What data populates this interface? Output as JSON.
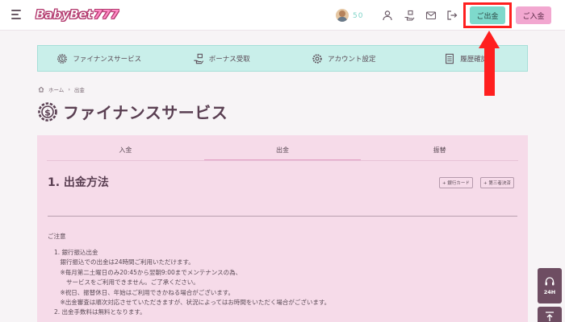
{
  "header": {
    "logo_text": "BabyBet",
    "logo_number": "777",
    "balance": "50",
    "withdraw_label": "ご出金",
    "deposit_label": "ご入金"
  },
  "service_nav": {
    "items": [
      {
        "label": "ファイナンスサービス",
        "icon": "dollar-gear-icon"
      },
      {
        "label": "ボーナス受取",
        "icon": "bonus-hand-icon"
      },
      {
        "label": "アカウント設定",
        "icon": "gear-icon"
      },
      {
        "label": "履歴確認",
        "icon": "document-icon"
      }
    ]
  },
  "breadcrumb": {
    "home": "ホーム",
    "current": "出金"
  },
  "page_title": "ファイナンスサービス",
  "tabs": [
    {
      "label": "入金",
      "active": false
    },
    {
      "label": "出金",
      "active": true
    },
    {
      "label": "振替",
      "active": false
    }
  ],
  "withdraw": {
    "title": "1. 出金方法",
    "methods": [
      "+ 銀行カード",
      "+ 第三者決済"
    ],
    "notice_heading": "ご注意",
    "lines": [
      "1. 銀行振込出金",
      "　銀行振込での出金は24時間ご利用いただけます。",
      "　※毎月第二土曜日のみ20:45から翌朝9:00までメンテナンスの為、",
      "　　サービスをご利用できません。ご了承ください。",
      "　※祝日、振替休日、年始はご利用できかねる場合がございます。",
      "　※出金審査は順次対応させていただきますが、状況によってはお時間をいただく場合がございます。",
      "2. 出金手数料は無料となります。"
    ]
  },
  "support": {
    "label": "24H"
  },
  "colors": {
    "accent_teal": "#7ed9cc",
    "accent_pink": "#f2a7d0",
    "panel_pink": "#f6dbe9",
    "highlight_red": "#ff1f1f"
  }
}
